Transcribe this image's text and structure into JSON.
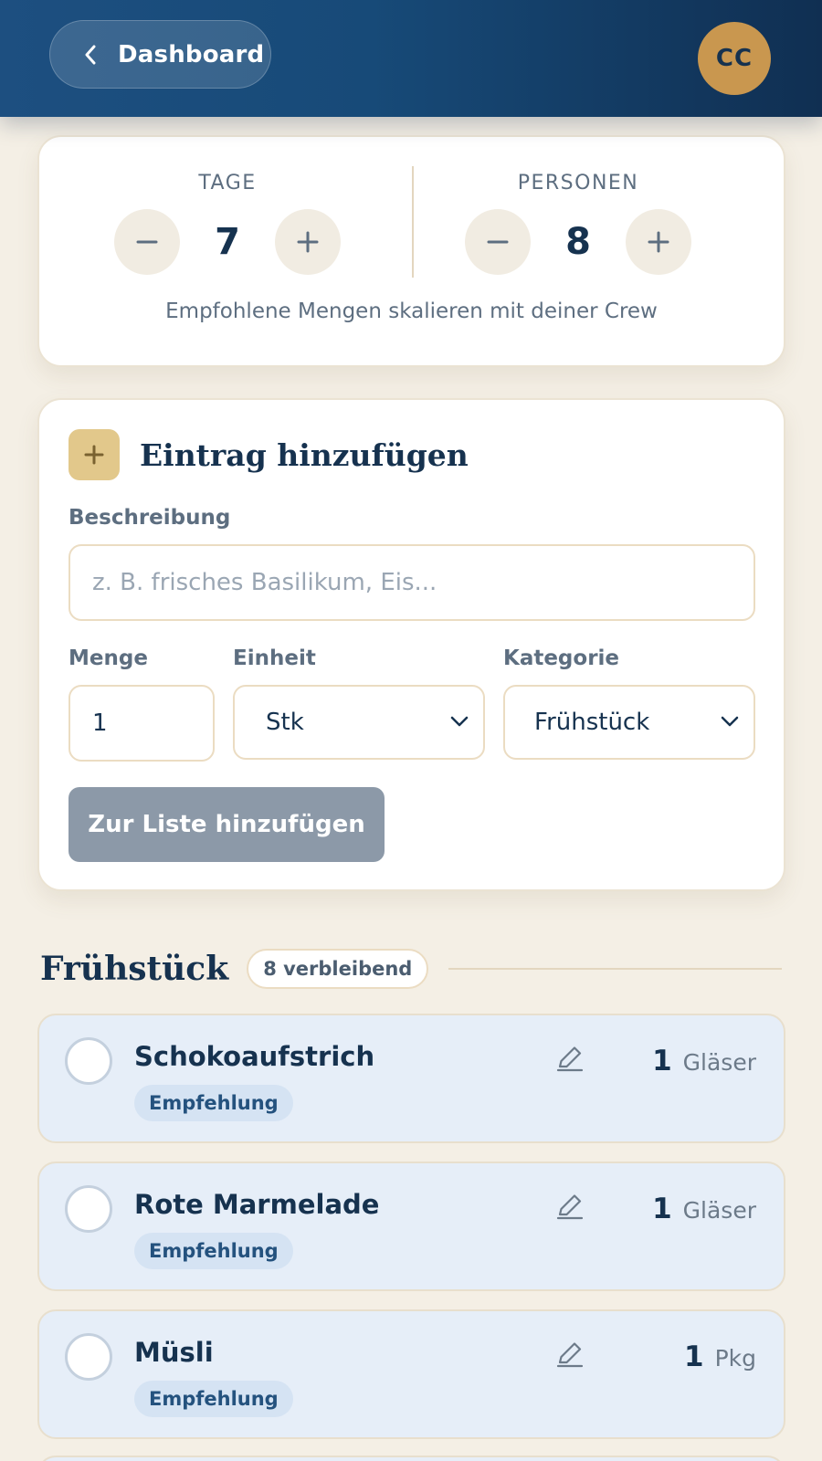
{
  "header": {
    "back_label": "Dashboard",
    "avatar_initials": "CC"
  },
  "counters": {
    "days": {
      "label": "TAGE",
      "value": "7"
    },
    "persons": {
      "label": "PERSONEN",
      "value": "8"
    },
    "note": "Empfohlene Mengen skalieren mit deiner Crew"
  },
  "add_entry": {
    "title": "Eintrag hinzufügen",
    "description_label": "Beschreibung",
    "description_placeholder": "z. B. frisches Basilikum, Eis...",
    "amount_label": "Menge",
    "amount_value": "1",
    "unit_label": "Einheit",
    "unit_value": "Stk",
    "category_label": "Kategorie",
    "category_value": "Frühstück",
    "submit_label": "Zur Liste hinzufügen"
  },
  "section": {
    "title": "Frühstück",
    "remaining_badge": "8 verbleibend"
  },
  "items": [
    {
      "name": "Schokoaufstrich",
      "tag": "Empfehlung",
      "qty": "1",
      "unit": "Gläser"
    },
    {
      "name": "Rote Marmelade",
      "tag": "Empfehlung",
      "qty": "1",
      "unit": "Gläser"
    },
    {
      "name": "Müsli",
      "tag": "Empfehlung",
      "qty": "1",
      "unit": "Pkg"
    }
  ],
  "colors": {
    "header_start": "#1d4f80",
    "header_end": "#102f52",
    "avatar": "#c9974f",
    "background": "#f4efe5",
    "item_bg": "#e6eef8",
    "accent_gold": "#e2c88b",
    "button_disabled": "#8c99a8"
  },
  "icons": [
    "chevron-left-icon",
    "minus-icon",
    "plus-icon",
    "chevron-down-icon",
    "pencil-icon"
  ]
}
